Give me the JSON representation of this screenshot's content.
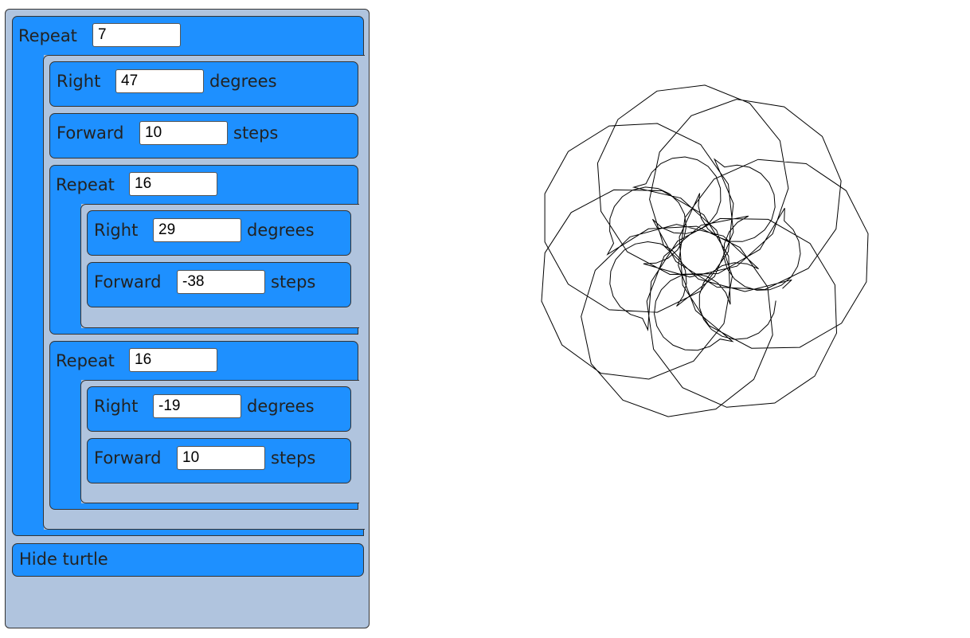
{
  "program": {
    "outer_repeat": {
      "label": "Repeat",
      "count": "7",
      "right1": {
        "label": "Right",
        "value": "47",
        "unit": "degrees"
      },
      "forward1": {
        "label": "Forward",
        "value": "10",
        "unit": "steps"
      },
      "repeat_a": {
        "label": "Repeat",
        "count": "16",
        "right": {
          "label": "Right",
          "value": "29",
          "unit": "degrees"
        },
        "forward": {
          "label": "Forward",
          "value": "-38",
          "unit": "steps"
        }
      },
      "repeat_b": {
        "label": "Repeat",
        "count": "16",
        "right": {
          "label": "Right",
          "value": "-19",
          "unit": "degrees"
        },
        "forward": {
          "label": "Forward",
          "value": "10",
          "unit": "steps"
        }
      }
    },
    "hide_turtle": {
      "label": "Hide turtle"
    }
  },
  "colors": {
    "block": "#1e90ff",
    "workspace": "#b0c4de",
    "stroke": "#000000"
  }
}
